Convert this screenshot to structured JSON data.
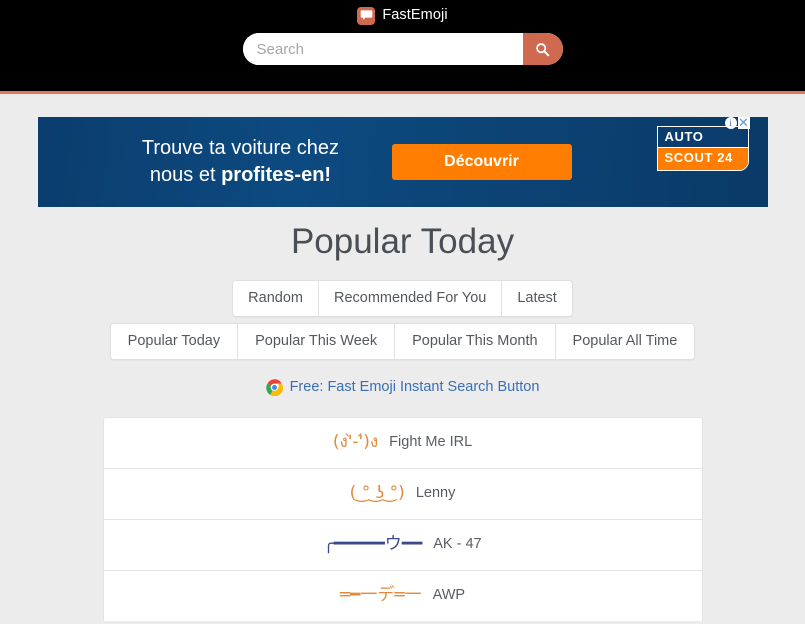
{
  "header": {
    "brand_name": "FastEmoji",
    "logo_icon": "speech-bubble-icon",
    "background_color": "#000000",
    "accent_color": "#cf6950"
  },
  "search": {
    "placeholder": "Search",
    "value": "",
    "button_icon": "magnifier-icon"
  },
  "ad": {
    "line1": "Trouve ta voiture chez",
    "line2_prefix": "nous et ",
    "line2_bold": "profites-en!",
    "cta_label": "Découvrir",
    "brand_top": "AUTO",
    "brand_bottom": "SCOUT 24",
    "info_icon": "adchoices-info-icon",
    "close_icon": "close-icon",
    "background_color": "#0b3d6e",
    "cta_color": "#ff7d00"
  },
  "main": {
    "title": "Popular Today",
    "primary_tabs": [
      {
        "label": "Random"
      },
      {
        "label": "Recommended For You"
      },
      {
        "label": "Latest"
      }
    ],
    "secondary_tabs": [
      {
        "label": "Popular Today"
      },
      {
        "label": "Popular This Week"
      },
      {
        "label": "Popular This Month"
      },
      {
        "label": "Popular All Time"
      }
    ],
    "extension_link": {
      "icon": "chrome-icon",
      "text": "Free: Fast Emoji Instant Search Button",
      "color": "#3a6fb5"
    },
    "emoji_rows": [
      {
        "art": "(ง'̀-'́)ง",
        "label": "Fight Me IRL",
        "art_color": "#e08a3c"
      },
      {
        "art": "( ͜° ͜ʖ ͜°)",
        "label": "Lenny",
        "art_color": "#e08a3c"
      },
      {
        "art": "╭━━━━━ウ━━",
        "label": "AK - 47",
        "art_color": "#3b4a8c"
      },
      {
        "art": "═━一デ═一",
        "label": "AWP",
        "art_color": "#e08a3c"
      }
    ]
  }
}
